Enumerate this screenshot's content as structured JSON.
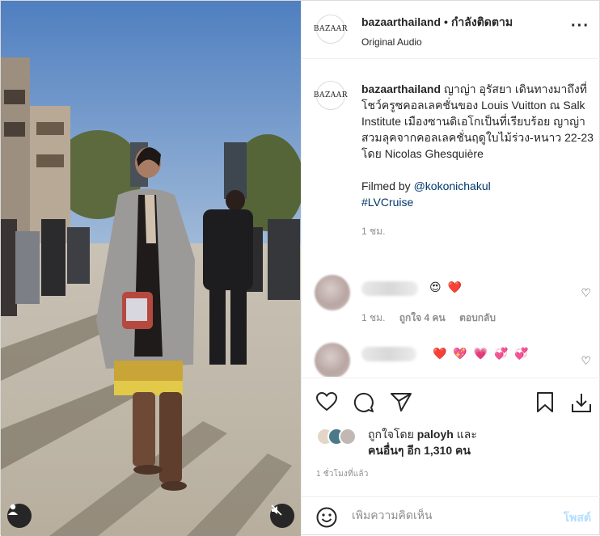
{
  "post": {
    "username": "bazaarthailand",
    "follow_status": "กำลังติดตาม",
    "audio": "Original Audio",
    "avatar_text": "BAZAAR",
    "more_icon": "more-horizontal-icon"
  },
  "caption": {
    "username": "bazaarthailand",
    "text": "ญาญ่า อุรัสยา เดินทางมาถึงที่โชว์ครูซคอลเลคชั่นของ Louis Vuitton ณ Salk Institute เมืองซานดิเอโกเป็นที่เรียบร้อย ญาญ่าสวมลุคจากคอลเลคชั่นฤดูใบไม้ร่วง-หนาว 22-23 โดย Nicolas Ghesquière",
    "filmed_by_label": "Filmed by",
    "filmed_by_handle": "@kokonichakul",
    "hashtag": "#LVCruise",
    "time": "1 ชม."
  },
  "comments": [
    {
      "emojis": "😍 ❤️",
      "time": "1 ชม.",
      "likes": "ถูกใจ 4 คน",
      "reply": "ตอบกลับ"
    },
    {
      "emojis": "❤️ 💖 💗 💞 💞"
    }
  ],
  "likes": {
    "prefix": "ถูกใจโดย",
    "user": "paloyh",
    "and": "และ",
    "others": "คนอื่นๆ อีก 1,310 คน"
  },
  "timestamp": "1 ชั่วโมงที่แล้ว",
  "comment_box": {
    "placeholder": "เพิ่มความคิดเห็น",
    "post_label": "โพสต์"
  },
  "colors": {
    "link": "#00376b",
    "post_button_disabled": "#b2dffc",
    "meta": "#8e8e8e"
  }
}
